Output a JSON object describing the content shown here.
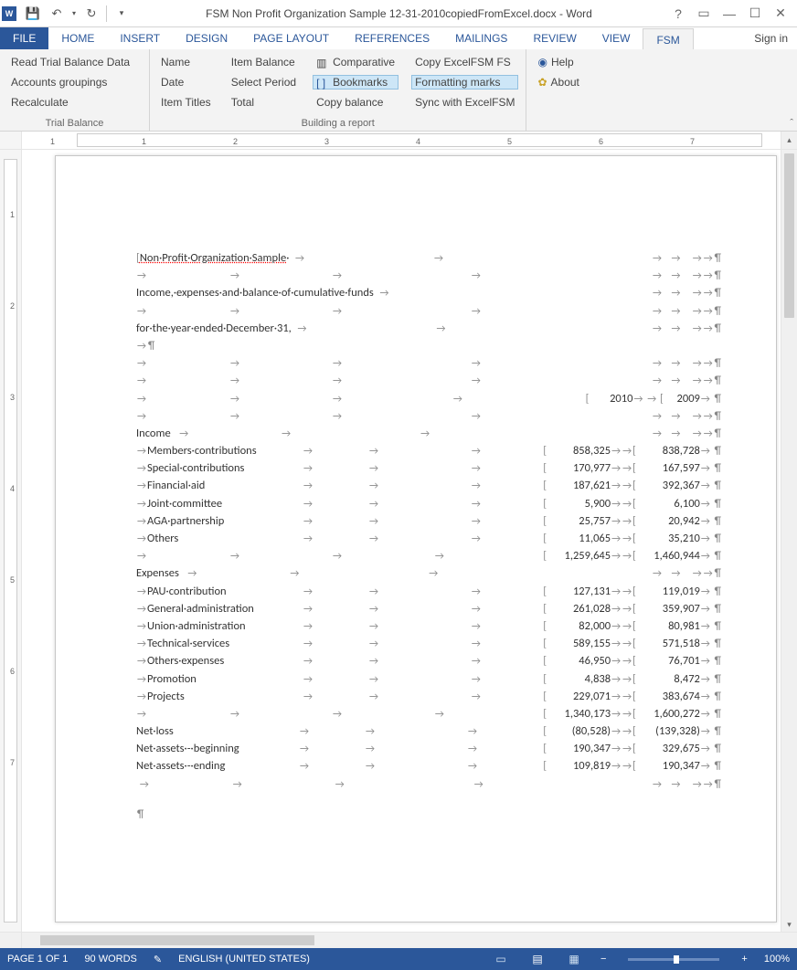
{
  "titlebar": {
    "title": "FSM Non Profit Organization Sample 12-31-2010copiedFromExcel.docx - Word"
  },
  "signin": "Sign in",
  "tabs": [
    "FILE",
    "HOME",
    "INSERT",
    "DESIGN",
    "PAGE LAYOUT",
    "REFERENCES",
    "MAILINGS",
    "REVIEW",
    "VIEW",
    "FSM"
  ],
  "active_tab": "FSM",
  "ribbon": {
    "group1": {
      "label": "Trial Balance",
      "items": [
        "Read Trial Balance Data",
        "Accounts groupings",
        "Recalculate"
      ]
    },
    "group2": {
      "label": "Building a report",
      "col1": [
        "Name",
        "Date",
        "Item Titles"
      ],
      "col2": [
        "Item Balance",
        "Select Period",
        "Total"
      ],
      "col3": [
        "Comparative",
        "Bookmarks",
        "Copy balance"
      ],
      "col4": [
        "Copy ExcelFSM FS",
        "Formatting marks",
        "Sync with ExcelFSM"
      ]
    },
    "group3": {
      "help": "Help",
      "about": "About"
    }
  },
  "ruler": {
    "nums": [
      "1",
      "1",
      "2",
      "3",
      "4",
      "5",
      "6",
      "7"
    ]
  },
  "vruler": {
    "nums": [
      "1",
      "2",
      "3",
      "4",
      "5",
      "6",
      "7"
    ]
  },
  "document": {
    "title": "Non·Profit·Organization·Sample",
    "subtitle": "Income,·expenses·and·balance·of·cumulative·funds",
    "period": "for·the·year·ended·December·31,",
    "year1": "2010",
    "year2": "2009",
    "income_label": "Income",
    "income_rows": [
      {
        "label": "Members·contributions",
        "v1": "858,325",
        "v2": "838,728"
      },
      {
        "label": "Special·contributions",
        "v1": "170,977",
        "v2": "167,597"
      },
      {
        "label": "Financial·aid",
        "v1": "187,621",
        "v2": "392,367"
      },
      {
        "label": "Joint·committee",
        "v1": "5,900",
        "v2": "6,100"
      },
      {
        "label": "AGA·partnership",
        "v1": "25,757",
        "v2": "20,942"
      },
      {
        "label": "Others",
        "v1": "11,065",
        "v2": "35,210"
      }
    ],
    "income_total": {
      "v1": "1,259,645",
      "v2": "1,460,944"
    },
    "expenses_label": "Expenses",
    "expense_rows": [
      {
        "label": "PAU·contribution",
        "v1": "127,131",
        "v2": "119,019"
      },
      {
        "label": "General·administration",
        "v1": "261,028",
        "v2": "359,907"
      },
      {
        "label": "Union·administration",
        "v1": "82,000",
        "v2": "80,981"
      },
      {
        "label": "Technical·services",
        "v1": "589,155",
        "v2": "571,518"
      },
      {
        "label": "Others·expenses",
        "v1": "46,950",
        "v2": "76,701"
      },
      {
        "label": "Promotion",
        "v1": "4,838",
        "v2": "8,472"
      },
      {
        "label": "Projects",
        "v1": "229,071",
        "v2": "383,674"
      }
    ],
    "expenses_total": {
      "v1": "1,340,173",
      "v2": "1,600,272"
    },
    "netloss": {
      "label": "Net·loss",
      "v1": "(80,528)",
      "v2": "(139,328)"
    },
    "netbeg": {
      "label": "Net·assets·-·beginning",
      "v1": "190,347",
      "v2": "329,675"
    },
    "netend": {
      "label": "Net·assets·-·ending",
      "v1": "109,819",
      "v2": "190,347"
    }
  },
  "statusbar": {
    "page": "PAGE 1 OF 1",
    "words": "90 WORDS",
    "lang": "ENGLISH (UNITED STATES)",
    "zoom": "100%"
  }
}
